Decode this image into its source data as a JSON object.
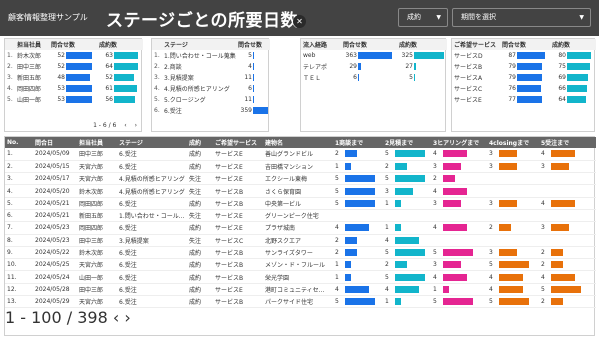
{
  "header": {
    "app_title": "顧客情報整理サンプル",
    "page_title": "ステージごとの所要日数",
    "filter_status": "成約",
    "filter_period": "期間を選択"
  },
  "colors": {
    "header_bg": "#434343",
    "bar_blue": "#1a73e8",
    "bar_teal": "#12b5cb",
    "bar_magenta": "#e52592",
    "bar_orange": "#e8710a"
  },
  "rep_table": {
    "headers": [
      "担当社員",
      "問合せ数",
      "成約数"
    ],
    "rows": [
      {
        "idx": "1.",
        "name": "鈴木次郎",
        "inq": 52,
        "won": 63
      },
      {
        "idx": "2.",
        "name": "田中三郎",
        "inq": 52,
        "won": 64
      },
      {
        "idx": "3.",
        "name": "新田五郎",
        "inq": 48,
        "won": 52
      },
      {
        "idx": "4.",
        "name": "岡田四郎",
        "inq": 53,
        "won": 61
      },
      {
        "idx": "5.",
        "name": "山田一郎",
        "inq": 53,
        "won": 56
      }
    ],
    "pager": "1 - 6 / 6"
  },
  "stage_table": {
    "headers": [
      "ステージ",
      "問合せ数"
    ],
    "rows": [
      {
        "idx": "1.",
        "name": "1.問い合わせ・コール蒐集",
        "inq": 5
      },
      {
        "idx": "2.",
        "name": "2.商談",
        "inq": 4
      },
      {
        "idx": "3.",
        "name": "3.見積提案",
        "inq": 11
      },
      {
        "idx": "4.",
        "name": "4.見積の所感ヒアリング",
        "inq": 6
      },
      {
        "idx": "5.",
        "name": "5.クロージング",
        "inq": 11
      },
      {
        "idx": "6.",
        "name": "6.受注",
        "inq": 359
      }
    ]
  },
  "channel_table": {
    "headers": [
      "流入経路",
      "問合せ数",
      "成約数"
    ],
    "rows": [
      {
        "idx": "1.",
        "name": "web",
        "inq": 363,
        "won": 325
      },
      {
        "idx": "2.",
        "name": "テレアポ",
        "inq": 29,
        "won": 27
      },
      {
        "idx": "3.",
        "name": "ＴＥＬ",
        "inq": 6,
        "won": 5
      }
    ]
  },
  "service_table": {
    "headers": [
      "ご希望サービス",
      "問合せ数",
      "成約数"
    ],
    "rows": [
      {
        "idx": "1.",
        "name": "サービスD",
        "inq": 87,
        "won": 80
      },
      {
        "idx": "2.",
        "name": "サービスB",
        "inq": 79,
        "won": 75
      },
      {
        "idx": "3.",
        "name": "サービスA",
        "inq": 79,
        "won": 69
      },
      {
        "idx": "4.",
        "name": "サービスC",
        "inq": 76,
        "won": 66
      },
      {
        "idx": "5.",
        "name": "サービスE",
        "inq": 77,
        "won": 64
      }
    ]
  },
  "main_table": {
    "headers": [
      "No.",
      "問合日",
      "担当社員",
      "ステージ",
      "成約",
      "ご希望サービス",
      "建物名",
      "1商談まで",
      "2見積まで",
      "3ヒアリングまで",
      "4closingまで",
      "5受注まで"
    ],
    "rows": [
      {
        "no": "1.",
        "date": "2024/05/09",
        "rep": "田中三郎",
        "stage": "6.受注",
        "deal": "成約",
        "service": "サービスE",
        "bldg": "善山グランドビル",
        "s1": 2,
        "s2": 5,
        "s3": 4,
        "s4": 3,
        "s5": 4
      },
      {
        "no": "2.",
        "date": "2024/05/15",
        "rep": "天宮六郎",
        "stage": "6.受注",
        "deal": "成約",
        "service": "サービスE",
        "bldg": "吉田橋マンション",
        "s1": 1,
        "s2": 2,
        "s3": 3,
        "s4": 3,
        "s5": 3
      },
      {
        "no": "3.",
        "date": "2024/05/17",
        "rep": "天宮六郎",
        "stage": "4.見積の所感ヒアリング",
        "deal": "失注",
        "service": "サービスE",
        "bldg": "エクシール東梅",
        "s1": 5,
        "s2": 5,
        "s3": 2,
        "s4": null,
        "s5": null
      },
      {
        "no": "4.",
        "date": "2024/05/20",
        "rep": "鈴木次郎",
        "stage": "4.見積の所感ヒアリング",
        "deal": "失注",
        "service": "サービスB",
        "bldg": "さくら保育園",
        "s1": 5,
        "s2": 3,
        "s3": 4,
        "s4": null,
        "s5": null
      },
      {
        "no": "5.",
        "date": "2024/05/21",
        "rep": "岡田四郎",
        "stage": "6.受注",
        "deal": "成約",
        "service": "サービスB",
        "bldg": "中央第一ビル",
        "s1": 5,
        "s2": 1,
        "s3": 3,
        "s4": 3,
        "s5": 4
      },
      {
        "no": "6.",
        "date": "2024/05/21",
        "rep": "新田五郎",
        "stage": "1.問い合わせ・コール...",
        "deal": "失注",
        "service": "サービスE",
        "bldg": "グリーンピーク住宅",
        "s1": null,
        "s2": null,
        "s3": null,
        "s4": null,
        "s5": null
      },
      {
        "no": "7.",
        "date": "2024/05/23",
        "rep": "岡田四郎",
        "stage": "6.受注",
        "deal": "成約",
        "service": "サービスE",
        "bldg": "プラザ城南",
        "s1": 4,
        "s2": 1,
        "s3": 4,
        "s4": 2,
        "s5": 3
      },
      {
        "no": "8.",
        "date": "2024/05/23",
        "rep": "田中三郎",
        "stage": "3.見積提案",
        "deal": "失注",
        "service": "サービスC",
        "bldg": "北野スクエア",
        "s1": 2,
        "s2": 4,
        "s3": null,
        "s4": null,
        "s5": null
      },
      {
        "no": "9.",
        "date": "2024/05/22",
        "rep": "鈴木次郎",
        "stage": "6.受注",
        "deal": "成約",
        "service": "サービスB",
        "bldg": "サンライズタワー",
        "s1": 2,
        "s2": 5,
        "s3": 5,
        "s4": 3,
        "s5": 2
      },
      {
        "no": "10.",
        "date": "2024/05/25",
        "rep": "天宮六郎",
        "stage": "6.受注",
        "deal": "成約",
        "service": "サービスB",
        "bldg": "メゾン・ド・フルール",
        "s1": 1,
        "s2": 2,
        "s3": 3,
        "s4": 5,
        "s5": 2
      },
      {
        "no": "11.",
        "date": "2024/05/24",
        "rep": "山田一郎",
        "stage": "6.受注",
        "deal": "成約",
        "service": "サービスB",
        "bldg": "栄光学園",
        "s1": 1,
        "s2": 5,
        "s3": 4,
        "s4": 4,
        "s5": 4
      },
      {
        "no": "12.",
        "date": "2024/05/28",
        "rep": "田中三郎",
        "stage": "6.受注",
        "deal": "成約",
        "service": "サービスE",
        "bldg": "港町コミュニティセ...",
        "s1": 4,
        "s2": 4,
        "s3": 1,
        "s4": 4,
        "s5": 5
      },
      {
        "no": "13.",
        "date": "2024/05/29",
        "rep": "天宮六郎",
        "stage": "6.受注",
        "deal": "成約",
        "service": "サービスB",
        "bldg": "パークサイド住宅",
        "s1": 5,
        "s2": 1,
        "s3": 5,
        "s4": 5,
        "s5": 2
      }
    ],
    "pager": "1 - 100 / 398"
  }
}
